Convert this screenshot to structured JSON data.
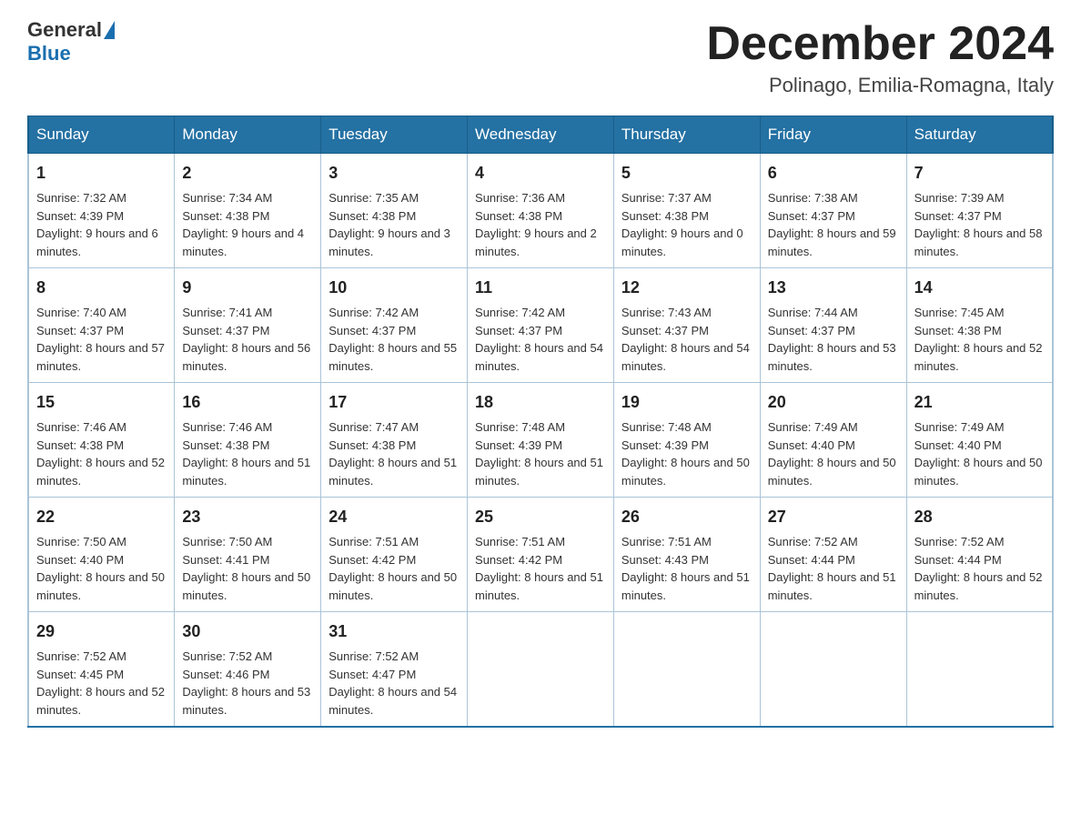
{
  "header": {
    "logo": {
      "general": "General",
      "blue": "Blue"
    },
    "title": "December 2024",
    "location": "Polinago, Emilia-Romagna, Italy"
  },
  "calendar": {
    "days_of_week": [
      "Sunday",
      "Monday",
      "Tuesday",
      "Wednesday",
      "Thursday",
      "Friday",
      "Saturday"
    ],
    "weeks": [
      [
        {
          "day": "1",
          "sunrise": "7:32 AM",
          "sunset": "4:39 PM",
          "daylight": "9 hours and 6 minutes."
        },
        {
          "day": "2",
          "sunrise": "7:34 AM",
          "sunset": "4:38 PM",
          "daylight": "9 hours and 4 minutes."
        },
        {
          "day": "3",
          "sunrise": "7:35 AM",
          "sunset": "4:38 PM",
          "daylight": "9 hours and 3 minutes."
        },
        {
          "day": "4",
          "sunrise": "7:36 AM",
          "sunset": "4:38 PM",
          "daylight": "9 hours and 2 minutes."
        },
        {
          "day": "5",
          "sunrise": "7:37 AM",
          "sunset": "4:38 PM",
          "daylight": "9 hours and 0 minutes."
        },
        {
          "day": "6",
          "sunrise": "7:38 AM",
          "sunset": "4:37 PM",
          "daylight": "8 hours and 59 minutes."
        },
        {
          "day": "7",
          "sunrise": "7:39 AM",
          "sunset": "4:37 PM",
          "daylight": "8 hours and 58 minutes."
        }
      ],
      [
        {
          "day": "8",
          "sunrise": "7:40 AM",
          "sunset": "4:37 PM",
          "daylight": "8 hours and 57 minutes."
        },
        {
          "day": "9",
          "sunrise": "7:41 AM",
          "sunset": "4:37 PM",
          "daylight": "8 hours and 56 minutes."
        },
        {
          "day": "10",
          "sunrise": "7:42 AM",
          "sunset": "4:37 PM",
          "daylight": "8 hours and 55 minutes."
        },
        {
          "day": "11",
          "sunrise": "7:42 AM",
          "sunset": "4:37 PM",
          "daylight": "8 hours and 54 minutes."
        },
        {
          "day": "12",
          "sunrise": "7:43 AM",
          "sunset": "4:37 PM",
          "daylight": "8 hours and 54 minutes."
        },
        {
          "day": "13",
          "sunrise": "7:44 AM",
          "sunset": "4:37 PM",
          "daylight": "8 hours and 53 minutes."
        },
        {
          "day": "14",
          "sunrise": "7:45 AM",
          "sunset": "4:38 PM",
          "daylight": "8 hours and 52 minutes."
        }
      ],
      [
        {
          "day": "15",
          "sunrise": "7:46 AM",
          "sunset": "4:38 PM",
          "daylight": "8 hours and 52 minutes."
        },
        {
          "day": "16",
          "sunrise": "7:46 AM",
          "sunset": "4:38 PM",
          "daylight": "8 hours and 51 minutes."
        },
        {
          "day": "17",
          "sunrise": "7:47 AM",
          "sunset": "4:38 PM",
          "daylight": "8 hours and 51 minutes."
        },
        {
          "day": "18",
          "sunrise": "7:48 AM",
          "sunset": "4:39 PM",
          "daylight": "8 hours and 51 minutes."
        },
        {
          "day": "19",
          "sunrise": "7:48 AM",
          "sunset": "4:39 PM",
          "daylight": "8 hours and 50 minutes."
        },
        {
          "day": "20",
          "sunrise": "7:49 AM",
          "sunset": "4:40 PM",
          "daylight": "8 hours and 50 minutes."
        },
        {
          "day": "21",
          "sunrise": "7:49 AM",
          "sunset": "4:40 PM",
          "daylight": "8 hours and 50 minutes."
        }
      ],
      [
        {
          "day": "22",
          "sunrise": "7:50 AM",
          "sunset": "4:40 PM",
          "daylight": "8 hours and 50 minutes."
        },
        {
          "day": "23",
          "sunrise": "7:50 AM",
          "sunset": "4:41 PM",
          "daylight": "8 hours and 50 minutes."
        },
        {
          "day": "24",
          "sunrise": "7:51 AM",
          "sunset": "4:42 PM",
          "daylight": "8 hours and 50 minutes."
        },
        {
          "day": "25",
          "sunrise": "7:51 AM",
          "sunset": "4:42 PM",
          "daylight": "8 hours and 51 minutes."
        },
        {
          "day": "26",
          "sunrise": "7:51 AM",
          "sunset": "4:43 PM",
          "daylight": "8 hours and 51 minutes."
        },
        {
          "day": "27",
          "sunrise": "7:52 AM",
          "sunset": "4:44 PM",
          "daylight": "8 hours and 51 minutes."
        },
        {
          "day": "28",
          "sunrise": "7:52 AM",
          "sunset": "4:44 PM",
          "daylight": "8 hours and 52 minutes."
        }
      ],
      [
        {
          "day": "29",
          "sunrise": "7:52 AM",
          "sunset": "4:45 PM",
          "daylight": "8 hours and 52 minutes."
        },
        {
          "day": "30",
          "sunrise": "7:52 AM",
          "sunset": "4:46 PM",
          "daylight": "8 hours and 53 minutes."
        },
        {
          "day": "31",
          "sunrise": "7:52 AM",
          "sunset": "4:47 PM",
          "daylight": "8 hours and 54 minutes."
        },
        null,
        null,
        null,
        null
      ]
    ],
    "labels": {
      "sunrise": "Sunrise:",
      "sunset": "Sunset:",
      "daylight": "Daylight:"
    }
  }
}
